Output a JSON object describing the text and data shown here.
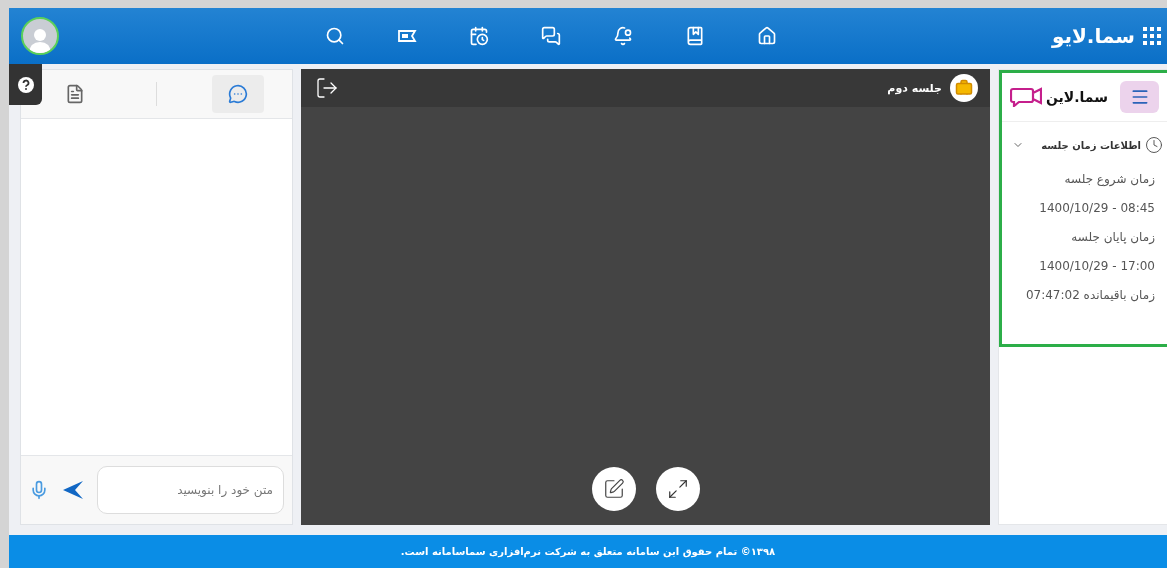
{
  "header": {
    "brand": "سما.لایو"
  },
  "chat_panel": {
    "tabs": [
      {
        "kind": "document",
        "selected": false
      },
      {
        "kind": "chat",
        "selected": true
      }
    ],
    "input": {
      "placeholder": "متن خود را بنویسید"
    }
  },
  "session": {
    "title": "جلسه دوم"
  },
  "sidebar": {
    "logo": "سما.لاین",
    "section": {
      "title": "اطلاعات زمان جلسه",
      "expanded": true,
      "lines": [
        "زمان شروع جلسه",
        "08:45 - 1400/10/29",
        "زمان پایان جلسه",
        "17:00 - 1400/10/29",
        "زمان باقیمانده 07:47:02"
      ]
    }
  },
  "footer": "۱۳۹۸© تمام حقوق این سامانه متعلق به شرکت نرم‌افزاری سماسامانه است."
}
